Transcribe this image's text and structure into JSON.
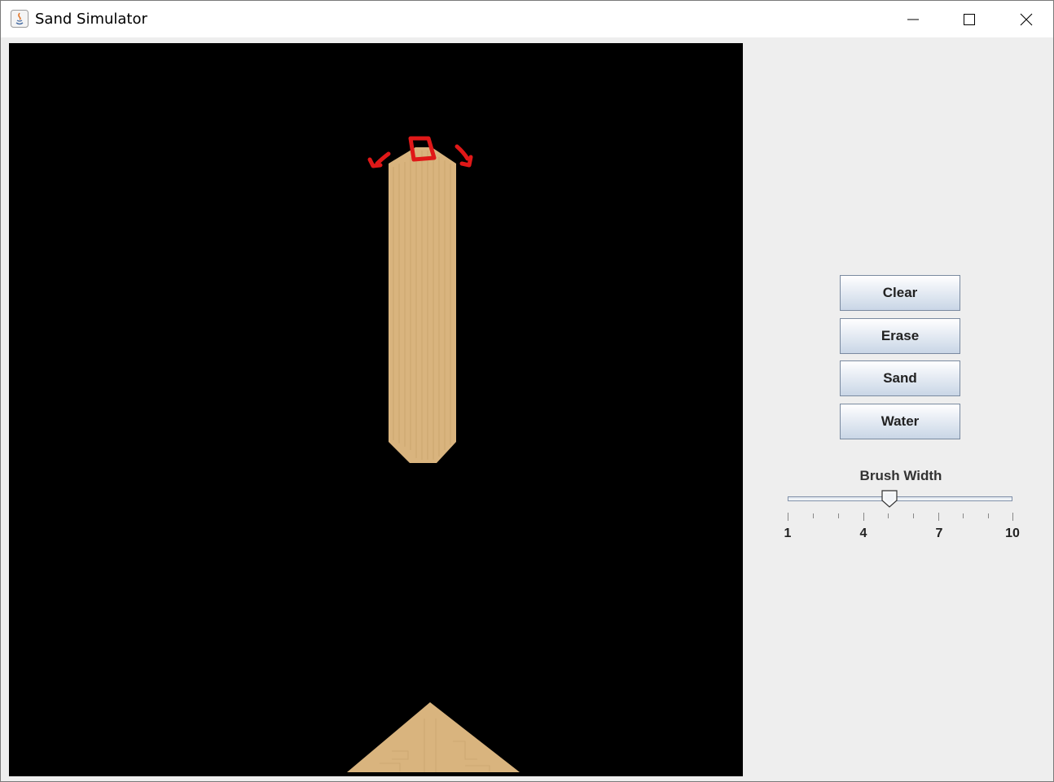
{
  "window": {
    "title": "Sand Simulator"
  },
  "controls": {
    "clear_label": "Clear",
    "erase_label": "Erase",
    "sand_label": "Sand",
    "water_label": "Water"
  },
  "slider": {
    "label": "Brush Width",
    "min": 1,
    "max": 10,
    "value": 5,
    "tick_labels": [
      "1",
      "4",
      "7",
      "10"
    ]
  },
  "colors": {
    "canvas_bg": "#000000",
    "sand": "#d9b47e",
    "annotation": "#e01818"
  }
}
